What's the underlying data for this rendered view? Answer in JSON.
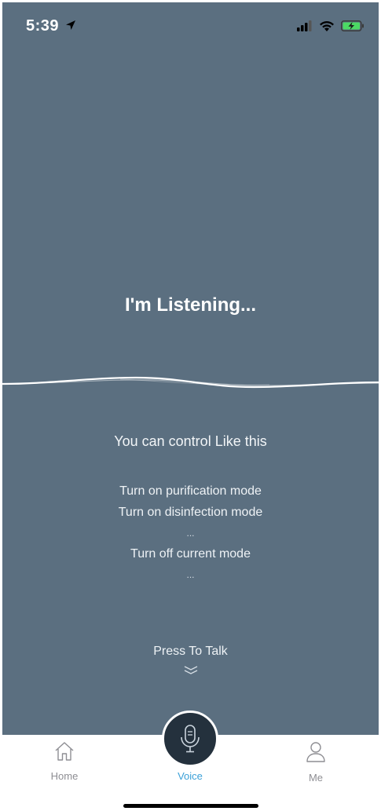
{
  "status_bar": {
    "time": "5:39"
  },
  "main": {
    "listening_text": "I'm Listening...",
    "hint_title": "You can control Like this",
    "examples": [
      "Turn on purification mode",
      "Turn on disinfection mode",
      "...",
      "Turn off current mode",
      "..."
    ],
    "press_to_talk": "Press To Talk"
  },
  "tabbar": {
    "home_label": "Home",
    "voice_label": "Voice",
    "me_label": "Me"
  },
  "colors": {
    "background": "#5b6f80",
    "mic_button": "#24313d",
    "active_tab": "#3aa0d8",
    "inactive_tab": "#8e8e93"
  },
  "icons": [
    "location-arrow-icon",
    "signal-icon",
    "wifi-icon",
    "battery-charging-icon",
    "home-icon",
    "microphone-icon",
    "user-icon",
    "chevron-double-down-icon"
  ]
}
